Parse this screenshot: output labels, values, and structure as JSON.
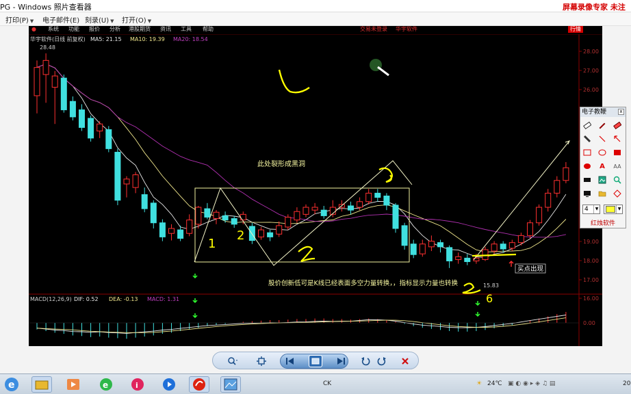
{
  "window": {
    "title": "PG - Windows 照片查看器",
    "recorder_text": "屏幕录像专家  未注"
  },
  "viewer_menu": [
    {
      "label": "打印(P)",
      "has_caret": true
    },
    {
      "label": "电子邮件(E)",
      "has_caret": false
    },
    {
      "label": "刻录(U)",
      "has_caret": true
    },
    {
      "label": "打开(O)",
      "has_caret": true
    }
  ],
  "software": {
    "menu": [
      "系统",
      "功能",
      "报价",
      "分析",
      "港股期货",
      "资讯",
      "工具",
      "帮助"
    ],
    "center_menu": [
      "交易未登录",
      "华宇软件"
    ],
    "right_badge": "行情",
    "stock_label": "华宇软件(日线 前复权)",
    "ma_labels": [
      {
        "label": "MA5: 21.15",
        "color": "#e8e8e8"
      },
      {
        "label": "MA10: 19.39",
        "color": "#f0e68c"
      },
      {
        "label": "MA20: 18.54",
        "color": "#c040c0"
      }
    ],
    "high_label": "28.48",
    "low_label": "15.83",
    "macd_label": "MACD(12,26,9)",
    "macd_values": [
      {
        "label": "DIF: 0.52",
        "color": "#e8e8e8"
      },
      {
        "label": "DEA: -0.13",
        "color": "#f0e68c"
      },
      {
        "label": "MACD: 1.31",
        "color": "#c040c0"
      }
    ],
    "price_axis": [
      "28.00",
      "27.00",
      "26.00",
      "19.00",
      "18.00",
      "17.00",
      "16.00"
    ],
    "macd_axis": [
      "0.00"
    ],
    "annotations": {
      "black_hole": "此处裂形成黑洞",
      "divergence": "股价创新低可是K线已经表面多空力量转换，，指标显示力量也转换",
      "buy_point": "买点出现"
    },
    "handwritten": [
      "1",
      "2",
      "2",
      "6"
    ]
  },
  "pen_palette": {
    "title": "电子教鞭",
    "close": "x",
    "size_value": "4",
    "brand": "红烛软件",
    "tools": [
      "eraser-icon",
      "pen-icon",
      "eraser-red-icon",
      "marker-icon",
      "line-icon",
      "arrow-icon",
      "rectangle-icon",
      "ellipse-icon",
      "filled-rect-icon",
      "filled-ellipse-icon",
      "text-a-icon",
      "text-aa-icon",
      "black-bar-icon",
      "image-icon",
      "zoom-icon",
      "screen-icon",
      "folder-icon",
      "diamond-icon"
    ]
  },
  "viewer_toolbar": [
    "zoom-icon",
    "actual-size-icon",
    "previous-icon",
    "slideshow-icon",
    "next-icon",
    "rotate-left-icon",
    "rotate-right-icon",
    "delete-icon"
  ],
  "taskbar": {
    "input_indicator": "CK",
    "weather": "24℃",
    "clock_fragment": "20"
  },
  "chart_data": {
    "type": "candlestick",
    "title": "华宇软件(日线 前复权)",
    "ma_lines": [
      "MA5",
      "MA10",
      "MA20"
    ],
    "y_ticks": [
      28.0,
      27.0,
      26.0,
      19.0,
      18.0,
      17.0,
      16.0
    ],
    "high": 28.48,
    "low": 15.83,
    "indicator": {
      "name": "MACD(12,26,9)",
      "DIF": 0.52,
      "DEA": -0.13,
      "MACD": 1.31
    },
    "candles": [
      {
        "o": 420,
        "c": 460,
        "h": 470,
        "l": 395
      },
      {
        "o": 450,
        "c": 470,
        "h": 480,
        "l": 410
      },
      {
        "o": 432,
        "c": 448,
        "h": 455,
        "l": 380
      },
      {
        "o": 445,
        "c": 400,
        "h": 450,
        "l": 396
      },
      {
        "o": 412,
        "c": 390,
        "h": 419,
        "l": 385
      },
      {
        "o": 400,
        "c": 375,
        "h": 408,
        "l": 370
      },
      {
        "o": 388,
        "c": 360,
        "h": 392,
        "l": 355
      },
      {
        "o": 370,
        "c": 380,
        "h": 384,
        "l": 360
      },
      {
        "o": 372,
        "c": 345,
        "h": 377,
        "l": 340
      },
      {
        "o": 340,
        "c": 272,
        "h": 345,
        "l": 265
      },
      {
        "o": 295,
        "c": 302,
        "h": 306,
        "l": 276
      },
      {
        "o": 290,
        "c": 308,
        "h": 312,
        "l": 282
      },
      {
        "o": 280,
        "c": 260,
        "h": 290,
        "l": 255
      },
      {
        "o": 268,
        "c": 240,
        "h": 272,
        "l": 232
      },
      {
        "o": 240,
        "c": 220,
        "h": 245,
        "l": 214
      },
      {
        "o": 225,
        "c": 232,
        "h": 238,
        "l": 215
      },
      {
        "o": 230,
        "c": 218,
        "h": 236,
        "l": 214
      },
      {
        "o": 225,
        "c": 244,
        "h": 252,
        "l": 221
      },
      {
        "o": 238,
        "c": 262,
        "h": 264,
        "l": 232
      },
      {
        "o": 260,
        "c": 248,
        "h": 268,
        "l": 245
      },
      {
        "o": 246,
        "c": 255,
        "h": 258,
        "l": 238
      },
      {
        "o": 250,
        "c": 244,
        "h": 256,
        "l": 240
      },
      {
        "o": 246,
        "c": 238,
        "h": 250,
        "l": 233
      },
      {
        "o": 244,
        "c": 252,
        "h": 256,
        "l": 238
      },
      {
        "o": 235,
        "c": 215,
        "h": 240,
        "l": 210
      },
      {
        "o": 220,
        "c": 230,
        "h": 234,
        "l": 216
      },
      {
        "o": 226,
        "c": 220,
        "h": 230,
        "l": 214
      },
      {
        "o": 224,
        "c": 236,
        "h": 242,
        "l": 220
      },
      {
        "o": 234,
        "c": 248,
        "h": 252,
        "l": 230
      },
      {
        "o": 244,
        "c": 256,
        "h": 262,
        "l": 240
      },
      {
        "o": 252,
        "c": 262,
        "h": 266,
        "l": 248
      },
      {
        "o": 258,
        "c": 262,
        "h": 268,
        "l": 252
      },
      {
        "o": 258,
        "c": 250,
        "h": 264,
        "l": 246
      },
      {
        "o": 252,
        "c": 262,
        "h": 272,
        "l": 248
      },
      {
        "o": 262,
        "c": 266,
        "h": 272,
        "l": 256
      },
      {
        "o": 264,
        "c": 258,
        "h": 270,
        "l": 252
      },
      {
        "o": 262,
        "c": 270,
        "h": 276,
        "l": 258
      },
      {
        "o": 270,
        "c": 282,
        "h": 288,
        "l": 266
      },
      {
        "o": 282,
        "c": 276,
        "h": 288,
        "l": 270
      },
      {
        "o": 278,
        "c": 265,
        "h": 282,
        "l": 258
      },
      {
        "o": 265,
        "c": 232,
        "h": 268,
        "l": 226
      },
      {
        "o": 236,
        "c": 208,
        "h": 240,
        "l": 202
      },
      {
        "o": 210,
        "c": 195,
        "h": 216,
        "l": 190
      },
      {
        "o": 196,
        "c": 210,
        "h": 216,
        "l": 192
      },
      {
        "o": 206,
        "c": 214,
        "h": 222,
        "l": 200
      },
      {
        "o": 212,
        "c": 206,
        "h": 216,
        "l": 198
      },
      {
        "o": 205,
        "c": 186,
        "h": 208,
        "l": 176
      },
      {
        "o": 188,
        "c": 192,
        "h": 198,
        "l": 182
      },
      {
        "o": 190,
        "c": 185,
        "h": 196,
        "l": 180
      },
      {
        "o": 186,
        "c": 190,
        "h": 196,
        "l": 182
      },
      {
        "o": 188,
        "c": 202,
        "h": 206,
        "l": 186
      },
      {
        "o": 200,
        "c": 210,
        "h": 214,
        "l": 196
      },
      {
        "o": 210,
        "c": 203,
        "h": 214,
        "l": 198
      },
      {
        "o": 204,
        "c": 212,
        "h": 216,
        "l": 200
      },
      {
        "o": 212,
        "c": 222,
        "h": 226,
        "l": 208
      },
      {
        "o": 222,
        "c": 240,
        "h": 244,
        "l": 218
      },
      {
        "o": 240,
        "c": 262,
        "h": 266,
        "l": 236
      },
      {
        "o": 262,
        "c": 282,
        "h": 288,
        "l": 256
      },
      {
        "o": 282,
        "c": 300,
        "h": 306,
        "l": 276
      },
      {
        "o": 300,
        "c": 318,
        "h": 326,
        "l": 296
      }
    ],
    "macd_hist": [
      -1.2,
      -1.5,
      -1.8,
      -2.0,
      -2.3,
      -2.4,
      -2.6,
      -2.5,
      -2.7,
      -2.8,
      -2.9,
      -2.7,
      -2.5,
      -2.3,
      -2.0,
      -1.8,
      -1.5,
      -1.2,
      -0.9,
      -0.6,
      -0.4,
      -0.2,
      0.0,
      0.2,
      0.3,
      0.4,
      0.5,
      0.5,
      0.6,
      0.7,
      0.7,
      0.8,
      0.8,
      0.7,
      0.7,
      0.6,
      0.7,
      0.8,
      0.7,
      0.5,
      0.2,
      -0.2,
      -0.6,
      -0.9,
      -1.1,
      -1.3,
      -1.5,
      -1.6,
      -1.6,
      -1.5,
      -1.3,
      -1.0,
      -0.7,
      -0.4,
      0.0,
      0.4,
      0.8,
      1.2,
      1.6,
      2.0
    ]
  }
}
